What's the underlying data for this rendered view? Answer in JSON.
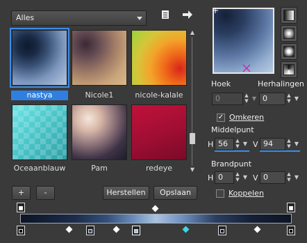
{
  "toolbar": {
    "category_value": "Alles",
    "new_icon": "new-file-icon",
    "export_icon": "arrow-right-icon"
  },
  "gallery": {
    "items": [
      {
        "label": "nastya",
        "selected": true
      },
      {
        "label": "Nicole1",
        "selected": false
      },
      {
        "label": "nicole-kalale",
        "selected": false
      },
      {
        "label": "Oceaanblauw",
        "selected": false
      },
      {
        "label": "Pam",
        "selected": false
      },
      {
        "label": "redeye",
        "selected": false
      }
    ]
  },
  "buttons": {
    "add": "+",
    "remove": "-",
    "reset": "Herstellen",
    "save": "Opslaan"
  },
  "settings": {
    "angle_label": "Hoek",
    "angle_value": "0",
    "repeat_label": "Herhalingen",
    "repeat_value": "0",
    "reverse_label": "Omkeren",
    "reverse_checked": true,
    "center_label": "Middelpunt",
    "center_h_label": "H",
    "center_h_value": "56",
    "center_v_label": "V",
    "center_v_value": "94",
    "focal_label": "Brandpunt",
    "focal_h_label": "H",
    "focal_h_value": "0",
    "focal_v_label": "V",
    "focal_v_value": "0",
    "link_label": "Koppelen",
    "link_checked": false
  },
  "colors": {
    "accent": "#3b8eea",
    "background": "#3a3a3a",
    "midpoint_marker": "#3ad9e8"
  }
}
